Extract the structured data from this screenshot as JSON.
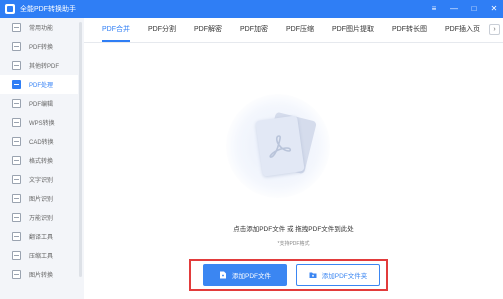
{
  "app": {
    "title": "全能PDF转换助手"
  },
  "window_controls": {
    "menu": "≡",
    "minimize": "—",
    "maximize": "□",
    "close": "✕"
  },
  "sidebar": {
    "items": [
      {
        "label": "常用功能",
        "icon": "star-doc-icon"
      },
      {
        "label": "PDF转换",
        "icon": "pdf-convert-icon"
      },
      {
        "label": "其他转PDF",
        "icon": "to-pdf-icon"
      },
      {
        "label": "PDF处理",
        "icon": "pdf-process-icon",
        "active": true
      },
      {
        "label": "PDF编辑",
        "icon": "pdf-edit-icon"
      },
      {
        "label": "WPS转换",
        "icon": "wps-icon"
      },
      {
        "label": "CAD转换",
        "icon": "cad-icon"
      },
      {
        "label": "格式转换",
        "icon": "format-icon"
      },
      {
        "label": "文字识别",
        "icon": "ocr-icon"
      },
      {
        "label": "图片识别",
        "icon": "image-ocr-icon"
      },
      {
        "label": "万能识别",
        "icon": "scan-icon"
      },
      {
        "label": "翻译工具",
        "icon": "translate-icon"
      },
      {
        "label": "压缩工具",
        "icon": "compress-icon"
      },
      {
        "label": "图片转换",
        "icon": "image-convert-icon"
      }
    ]
  },
  "tabs": [
    {
      "label": "PDF合并",
      "active": true
    },
    {
      "label": "PDF分割"
    },
    {
      "label": "PDF解密"
    },
    {
      "label": "PDF加密"
    },
    {
      "label": "PDF压缩"
    },
    {
      "label": "PDF图片提取"
    },
    {
      "label": "PDF转长图"
    },
    {
      "label": "PDF插入页"
    }
  ],
  "tab_more": "›",
  "drop": {
    "hint": "点击添加PDF文件 或 拖拽PDF文件到此处",
    "sub_hint": "*支持PDF格式"
  },
  "buttons": {
    "add_file": "添加PDF文件",
    "add_folder": "添加PDF文件夹"
  },
  "colors": {
    "accent": "#2f7ef5",
    "highlight_frame": "#e23b3b"
  }
}
